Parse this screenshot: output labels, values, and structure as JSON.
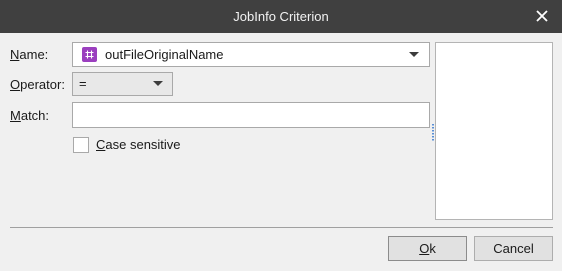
{
  "window": {
    "title": "JobInfo Criterion",
    "close_icon": "close-icon"
  },
  "form": {
    "name_label_mnemonic": "N",
    "name_label_rest": "ame:",
    "name_value": "outFileOriginalName",
    "name_icon": "hash-tag-icon",
    "name_icon_color": "#9b3fbf",
    "operator_label_mnemonic": "O",
    "operator_label_rest": "perator:",
    "operator_value": "=",
    "match_label_mnemonic": "M",
    "match_label_rest": "atch:",
    "match_value": "",
    "case_label_mnemonic": "C",
    "case_label_rest": "ase sensitive",
    "case_checked": false
  },
  "buttons": {
    "ok_mnemonic": "O",
    "ok_rest": "k",
    "cancel": "Cancel"
  },
  "colors": {
    "titlebar": "#404040",
    "background": "#f0f0f0"
  }
}
